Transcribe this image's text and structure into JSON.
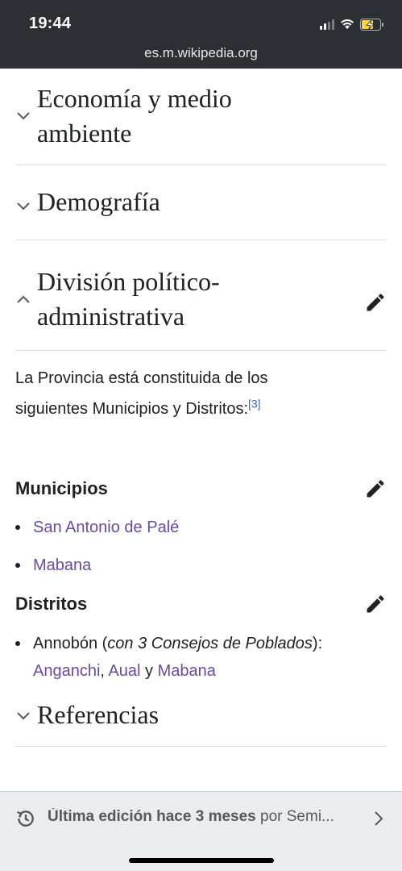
{
  "status_bar": {
    "time": "19:44",
    "url": "es.m.wikipedia.org"
  },
  "sections": {
    "economia": {
      "title_line1": "Economía y medio",
      "title_line2": "ambiente"
    },
    "demografia": {
      "title": "Demografía"
    },
    "division": {
      "title_line1": "División político-",
      "title_line2": "administrativa"
    },
    "referencias": {
      "title": "Referencias"
    }
  },
  "body": {
    "paragraph_line1": "La Provincia está constituida de los",
    "paragraph_line2": "siguientes Municipios y Distritos:",
    "ref_mark": "[3]"
  },
  "municipios": {
    "heading": "Municipios",
    "items": [
      "San Antonio de Palé",
      "Mabana"
    ]
  },
  "distritos": {
    "heading": "Distritos",
    "item_prefix": "Annobón (",
    "item_italic": "con 3 Consejos de Poblados",
    "item_suffix": "):",
    "links": [
      "Anganchi",
      "Aual",
      "Mabana"
    ],
    "sep_comma": ",",
    "sep_y": " y "
  },
  "footer": {
    "last_edit_bold": "Última edición hace 3 meses",
    "last_edit_rest": " por Semi..."
  },
  "colors": {
    "link": "#6b4ba1",
    "ref_link": "#3366cc",
    "topbar": "#2c2f33",
    "footer": "#eaecf0"
  }
}
